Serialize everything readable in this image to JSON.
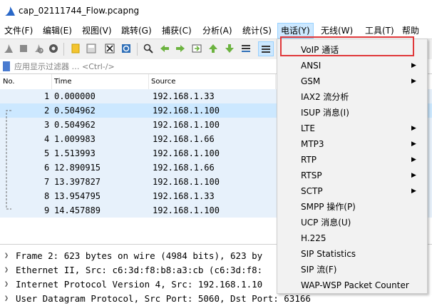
{
  "window": {
    "title": "cap_02111744_Flow.pcapng"
  },
  "menubar": [
    "文件(F)",
    "编辑(E)",
    "视图(V)",
    "跳转(G)",
    "捕获(C)",
    "分析(A)",
    "统计(S)",
    "电话(Y)",
    "无线(W)",
    "工具(T)",
    "帮助(H)"
  ],
  "filter": {
    "placeholder": "应用显示过滤器 … <Ctrl-/>"
  },
  "packet_list": {
    "columns": [
      "No.",
      "Time",
      "Source"
    ],
    "rows": [
      {
        "no": "1",
        "time": "0.000000",
        "source": "192.168.1.33"
      },
      {
        "no": "2",
        "time": "0.504962",
        "source": "192.168.1.100"
      },
      {
        "no": "3",
        "time": "0.504962",
        "source": "192.168.1.100"
      },
      {
        "no": "4",
        "time": "1.009983",
        "source": "192.168.1.66"
      },
      {
        "no": "5",
        "time": "1.513993",
        "source": "192.168.1.100"
      },
      {
        "no": "6",
        "time": "12.890915",
        "source": "192.168.1.66"
      },
      {
        "no": "7",
        "time": "13.397827",
        "source": "192.168.1.100"
      },
      {
        "no": "8",
        "time": "13.954795",
        "source": "192.168.1.33"
      },
      {
        "no": "9",
        "time": "14.457889",
        "source": "192.168.1.100"
      }
    ]
  },
  "details": [
    "Frame 2: 623 bytes on wire (4984 bits), 623 by",
    "Ethernet II, Src: c6:3d:f8:b8:a3:cb (c6:3d:f8:",
    "Internet Protocol Version 4, Src: 192.168.1.10",
    "User Datagram Protocol, Src Port: 5060, Dst Port: 63166"
  ],
  "telephony_menu": {
    "items": [
      {
        "label": "VoIP 通话",
        "sub": false
      },
      {
        "label": "ANSI",
        "sub": true
      },
      {
        "label": "GSM",
        "sub": true
      },
      {
        "label": "IAX2 流分析",
        "sub": false
      },
      {
        "label": "ISUP 消息(I)",
        "sub": false
      },
      {
        "label": "LTE",
        "sub": true
      },
      {
        "label": "MTP3",
        "sub": true
      },
      {
        "label": "RTP",
        "sub": true
      },
      {
        "label": "RTSP",
        "sub": true
      },
      {
        "label": "SCTP",
        "sub": true
      },
      {
        "label": "SMPP 操作(P)",
        "sub": false
      },
      {
        "label": "UCP 消息(U)",
        "sub": false
      },
      {
        "label": "H.225",
        "sub": false
      },
      {
        "label": "SIP Statistics",
        "sub": false
      },
      {
        "label": "SIP 流(F)",
        "sub": false
      },
      {
        "label": "WAP-WSP Packet Counter",
        "sub": false
      }
    ]
  },
  "icons": [
    "shark-fin-icon",
    "start-capture-icon",
    "stop-capture-icon",
    "restart-capture-icon",
    "capture-options-icon",
    "open-file-icon",
    "save-file-icon",
    "close-file-icon",
    "reload-file-icon",
    "find-packet-icon",
    "go-back-icon",
    "go-forward-icon",
    "go-to-packet-icon",
    "go-first-icon",
    "go-last-icon",
    "autoscroll-icon",
    "colorize-icon",
    "bookmark-icon",
    "submenu-arrow-icon",
    "expand-arrow-icon"
  ],
  "colors": {
    "selected_row": "#cce8ff",
    "highlight_row": "#e7f1fb",
    "highlight_box": "#e0383a",
    "menu_bg": "#f2f2f2"
  }
}
